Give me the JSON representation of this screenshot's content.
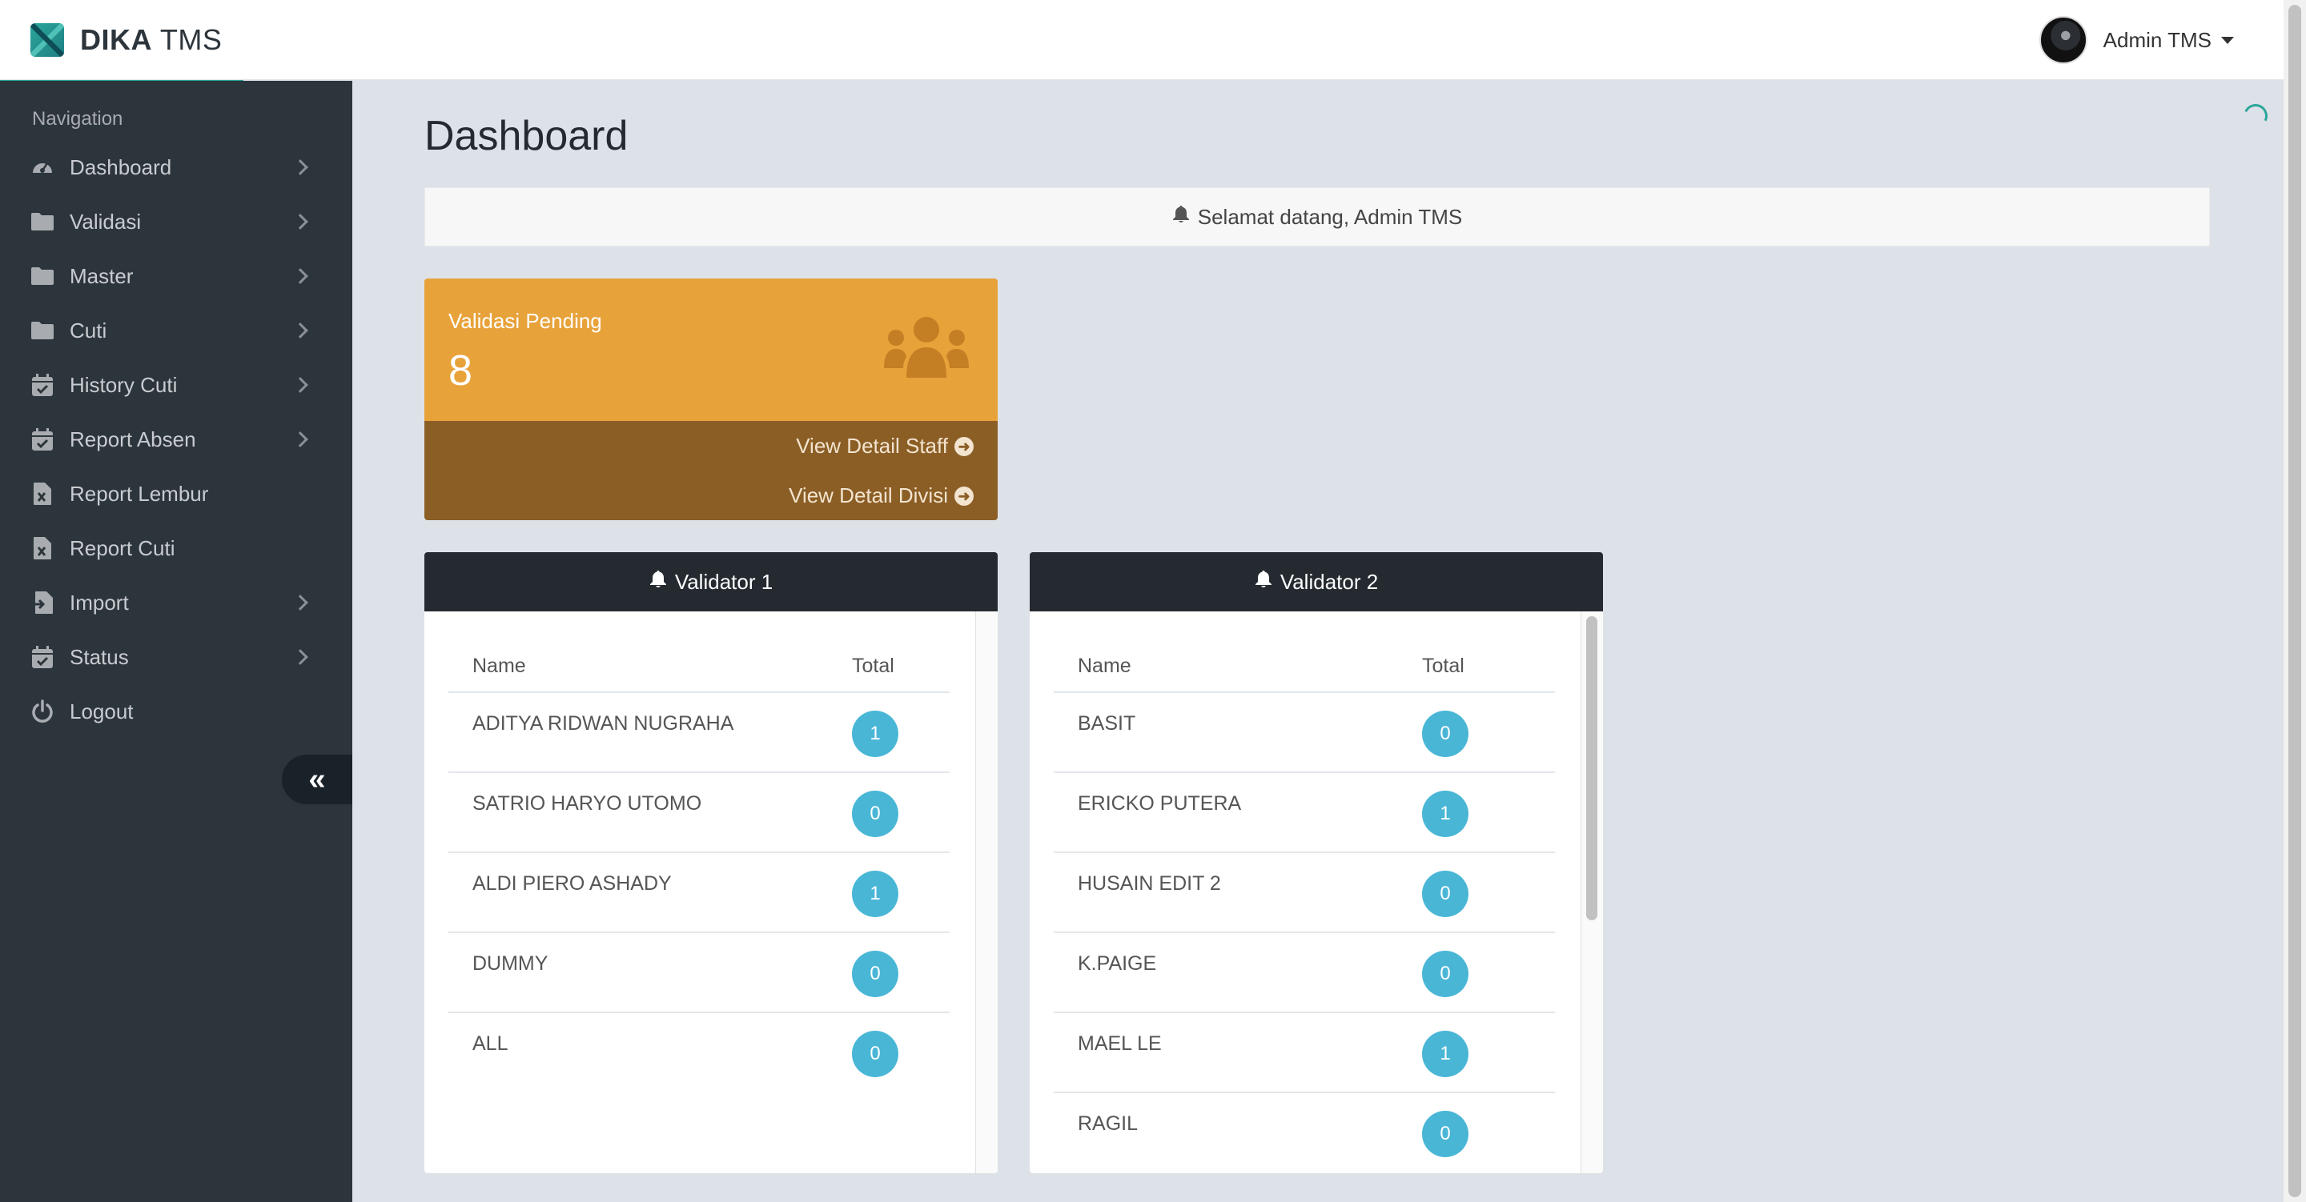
{
  "header": {
    "brand_bold": "DIKA",
    "brand_light": "TMS",
    "user_name": "Admin TMS"
  },
  "sidebar": {
    "nav_header": "Navigation",
    "items": [
      {
        "label": "Dashboard",
        "icon": "dashboard-gauge-icon",
        "has_chevron": true
      },
      {
        "label": "Validasi",
        "icon": "folder-icon",
        "has_chevron": true
      },
      {
        "label": "Master",
        "icon": "folder-icon",
        "has_chevron": true
      },
      {
        "label": "Cuti",
        "icon": "folder-icon",
        "has_chevron": true
      },
      {
        "label": "History Cuti",
        "icon": "calendar-check-icon",
        "has_chevron": true
      },
      {
        "label": "Report Absen",
        "icon": "calendar-check-icon",
        "has_chevron": true
      },
      {
        "label": "Report Lembur",
        "icon": "file-excel-icon",
        "has_chevron": false
      },
      {
        "label": "Report Cuti",
        "icon": "file-excel-icon",
        "has_chevron": false
      },
      {
        "label": "Import",
        "icon": "file-import-icon",
        "has_chevron": true
      },
      {
        "label": "Status",
        "icon": "calendar-check-icon",
        "has_chevron": true
      },
      {
        "label": "Logout",
        "icon": "power-icon",
        "has_chevron": false
      }
    ],
    "collapse_icon": "double-chevron-left-icon"
  },
  "main": {
    "page_title": "Dashboard",
    "welcome_text": "Selamat datang, Admin TMS",
    "stat_card": {
      "title": "Validasi Pending",
      "value": "8",
      "link_staff": "View Detail Staff",
      "link_divisi": "View Detail Divisi",
      "icon": "users-icon"
    },
    "validator1": {
      "title": "Validator 1",
      "col_name": "Name",
      "col_total": "Total",
      "rows": [
        {
          "name": "ADITYA RIDWAN NUGRAHA",
          "total": "1"
        },
        {
          "name": "SATRIO HARYO UTOMO",
          "total": "0"
        },
        {
          "name": "ALDI PIERO ASHADY",
          "total": "1"
        },
        {
          "name": "DUMMY",
          "total": "0"
        },
        {
          "name": "ALL",
          "total": "0"
        }
      ]
    },
    "validator2": {
      "title": "Validator 2",
      "col_name": "Name",
      "col_total": "Total",
      "rows": [
        {
          "name": "BASIT",
          "total": "0"
        },
        {
          "name": "ERICKO PUTERA",
          "total": "1"
        },
        {
          "name": "HUSAIN EDIT 2",
          "total": "0"
        },
        {
          "name": "K.PAIGE",
          "total": "0"
        },
        {
          "name": "MAEL LE",
          "total": "1"
        },
        {
          "name": "RAGIL",
          "total": "0"
        }
      ]
    }
  },
  "colors": {
    "accent": "#2aa69a",
    "sidebar_bg": "#2d353c",
    "stat_top": "#e8a23a",
    "stat_bottom": "#8b5e26",
    "badge": "#49b6d6",
    "panel_head": "#242a30"
  }
}
